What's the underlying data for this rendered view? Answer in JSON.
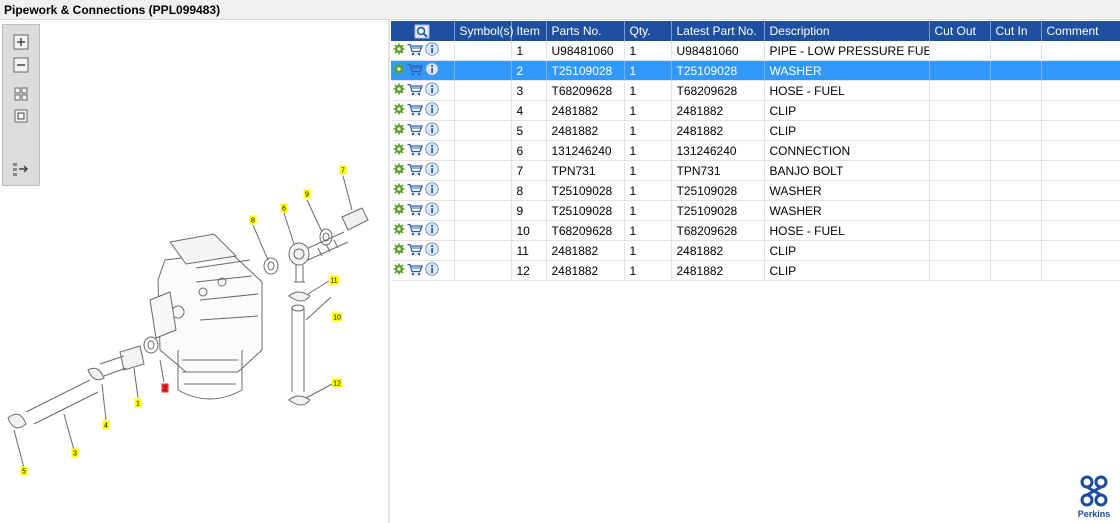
{
  "window": {
    "title": "Pipework & Connections (PPL099483)"
  },
  "toolbox": {
    "tools": [
      {
        "name": "zoom-in-icon"
      },
      {
        "name": "zoom-out-icon"
      },
      {
        "name": "fit-all-icon"
      },
      {
        "name": "actual-size-icon"
      },
      {
        "name": "show-list-icon"
      }
    ]
  },
  "diagram": {
    "callouts": [
      {
        "label": "7",
        "color": "#ffff00"
      },
      {
        "label": "9",
        "color": "#ffff00"
      },
      {
        "label": "6",
        "color": "#ffff00"
      },
      {
        "label": "8",
        "color": "#ffff00"
      },
      {
        "label": "11",
        "color": "#ffff00"
      },
      {
        "label": "10",
        "color": "#ffff00"
      },
      {
        "label": "2",
        "color": "#ff2a2a"
      },
      {
        "label": "12",
        "color": "#ffff00"
      },
      {
        "label": "1",
        "color": "#ffff00"
      },
      {
        "label": "4",
        "color": "#ffff00"
      },
      {
        "label": "3",
        "color": "#ffff00"
      },
      {
        "label": "5",
        "color": "#ffff00"
      }
    ]
  },
  "grid": {
    "header_icon": "search-icon",
    "columns": [
      "Symbol(s)",
      "Item",
      "Parts No.",
      "Qty.",
      "Latest Part No.",
      "Description",
      "Cut Out",
      "Cut In",
      "Comment"
    ],
    "selected_row": 1,
    "rows": [
      {
        "item": "1",
        "part_no": "U98481060",
        "qty": "1",
        "latest": "U98481060",
        "description": "PIPE - LOW PRESSURE FUEL"
      },
      {
        "item": "2",
        "part_no": "T25109028",
        "qty": "1",
        "latest": "T25109028",
        "description": "WASHER"
      },
      {
        "item": "3",
        "part_no": "T68209628",
        "qty": "1",
        "latest": "T68209628",
        "description": "HOSE - FUEL"
      },
      {
        "item": "4",
        "part_no": "2481882",
        "qty": "1",
        "latest": "2481882",
        "description": "CLIP"
      },
      {
        "item": "5",
        "part_no": "2481882",
        "qty": "1",
        "latest": "2481882",
        "description": "CLIP"
      },
      {
        "item": "6",
        "part_no": "131246240",
        "qty": "1",
        "latest": "131246240",
        "description": "CONNECTION"
      },
      {
        "item": "7",
        "part_no": "TPN731",
        "qty": "1",
        "latest": "TPN731",
        "description": "BANJO BOLT"
      },
      {
        "item": "8",
        "part_no": "T25109028",
        "qty": "1",
        "latest": "T25109028",
        "description": "WASHER"
      },
      {
        "item": "9",
        "part_no": "T25109028",
        "qty": "1",
        "latest": "T25109028",
        "description": "WASHER"
      },
      {
        "item": "10",
        "part_no": "T68209628",
        "qty": "1",
        "latest": "T68209628",
        "description": "HOSE - FUEL"
      },
      {
        "item": "11",
        "part_no": "2481882",
        "qty": "1",
        "latest": "2481882",
        "description": "CLIP"
      },
      {
        "item": "12",
        "part_no": "2481882",
        "qty": "1",
        "latest": "2481882",
        "description": "CLIP"
      }
    ],
    "row_icons": [
      "settings-icon",
      "cart-icon",
      "info-icon"
    ]
  },
  "brand": {
    "name": "Perkins",
    "color": "#1c4a9c"
  },
  "colors": {
    "header": "#1e4fa0",
    "selected": "#3398fc"
  }
}
